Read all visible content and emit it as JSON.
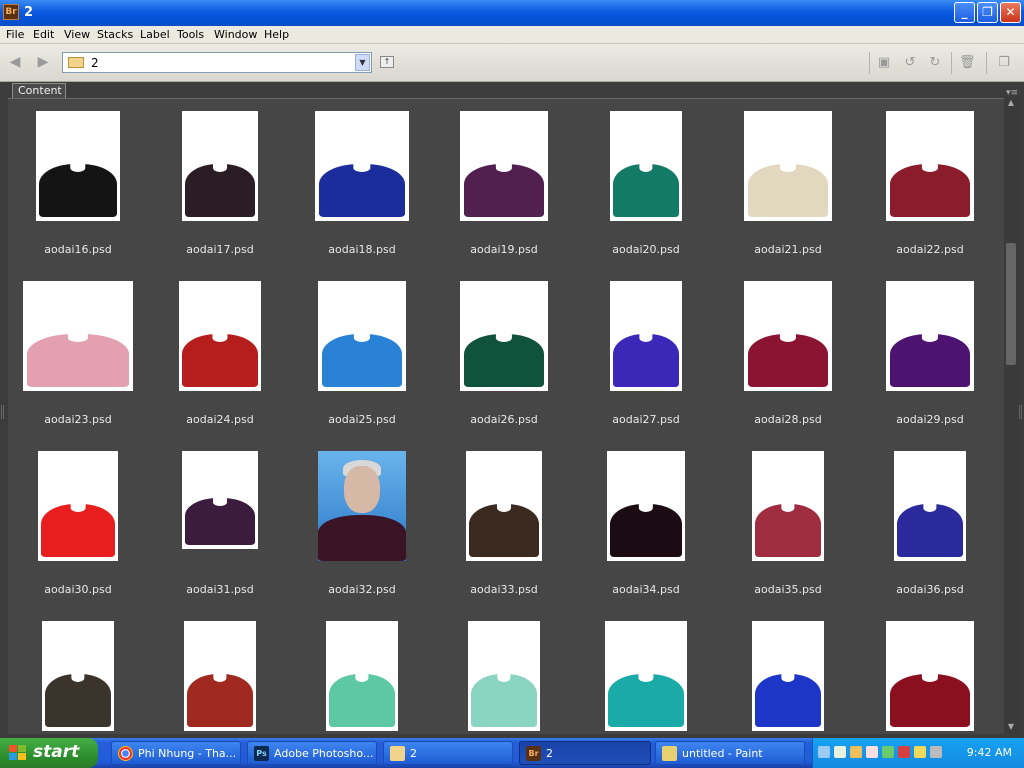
{
  "window": {
    "app_icon": "Br",
    "title": "2"
  },
  "window_controls": {
    "minimize": "_",
    "restore": "❐",
    "close": "✕"
  },
  "menu": [
    "File",
    "Edit",
    "View",
    "Stacks",
    "Label",
    "Tools",
    "Window",
    "Help"
  ],
  "toolbar": {
    "path": "2"
  },
  "panel": {
    "tab_label": "Content"
  },
  "thumbnails": [
    {
      "name": "aodai16.psd",
      "color": "#141414"
    },
    {
      "name": "aodai17.psd",
      "color": "#2a1e24"
    },
    {
      "name": "aodai18.psd",
      "color": "#1b2d9c"
    },
    {
      "name": "aodai19.psd",
      "color": "#52204e"
    },
    {
      "name": "aodai20.psd",
      "color": "#137a66"
    },
    {
      "name": "aodai21.psd",
      "color": "#e2d8c0"
    },
    {
      "name": "aodai22.psd",
      "color": "#8a1c2c"
    },
    {
      "name": "aodai23.psd",
      "color": "#e2a0b0"
    },
    {
      "name": "aodai24.psd",
      "color": "#b61e1e"
    },
    {
      "name": "aodai25.psd",
      "color": "#2a82d6"
    },
    {
      "name": "aodai26.psd",
      "color": "#10533c"
    },
    {
      "name": "aodai27.psd",
      "color": "#3c28b8"
    },
    {
      "name": "aodai28.psd",
      "color": "#8a1432"
    },
    {
      "name": "aodai29.psd",
      "color": "#4c1470"
    },
    {
      "name": "aodai30.psd",
      "color": "#e81e1e"
    },
    {
      "name": "aodai31.psd",
      "color": "#3c1c3c"
    },
    {
      "name": "aodai32.psd",
      "color": "#3a1424",
      "portrait": true
    },
    {
      "name": "aodai33.psd",
      "color": "#3a2a20"
    },
    {
      "name": "aodai34.psd",
      "color": "#1a0c12"
    },
    {
      "name": "aodai35.psd",
      "color": "#a02c40"
    },
    {
      "name": "aodai36.psd",
      "color": "#2a2a9c"
    },
    {
      "name": "",
      "color": "#3a342c"
    },
    {
      "name": "",
      "color": "#a02a20"
    },
    {
      "name": "",
      "color": "#5cc9a4"
    },
    {
      "name": "",
      "color": "#8ad4c2"
    },
    {
      "name": "",
      "color": "#1aaaa8"
    },
    {
      "name": "",
      "color": "#1e36c8"
    },
    {
      "name": "",
      "color": "#8a1020"
    }
  ],
  "taskbar": {
    "start_label": "start",
    "tasks": [
      {
        "label": "Phi Nhung - Tha...",
        "icon": "chrome-icon"
      },
      {
        "label": "Adobe Photosho...",
        "icon": "photoshop-icon",
        "icon_text": "Ps"
      },
      {
        "label": "2",
        "icon": "folder-icon"
      },
      {
        "label": "2",
        "icon": "bridge-icon",
        "icon_text": "Br",
        "active": true
      },
      {
        "label": "untitled - Paint",
        "icon": "paint-icon"
      }
    ],
    "clock": "9:42 AM"
  }
}
